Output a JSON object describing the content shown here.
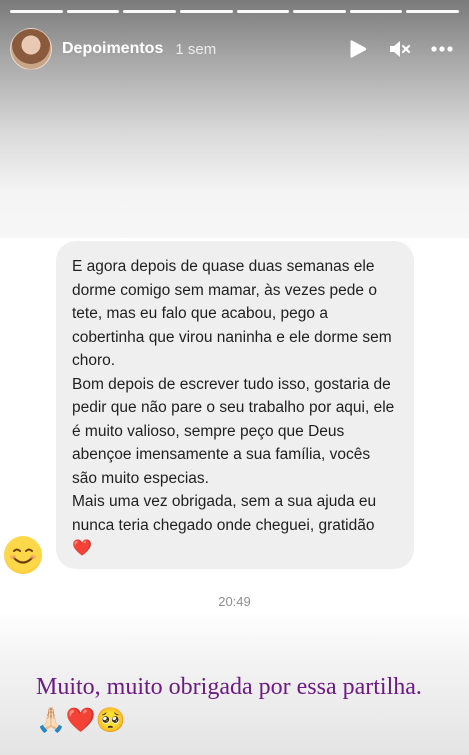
{
  "story": {
    "username": "Depoimentos",
    "time_ago": "1 sem",
    "progress_segments": 8,
    "progress_active": 8
  },
  "icons": {
    "play": "play-icon",
    "mute": "speaker-muted-icon",
    "more": "more-horizontal-icon"
  },
  "message": {
    "paragraphs": [
      "E agora depois de quase duas semanas ele dorme comigo sem mamar, às vezes pede o tete, mas eu falo que acabou, pego a cobertinha que virou naninha e ele dorme sem choro.",
      "Bom depois de escrever tudo isso, gostaria de pedir que não pare o seu trabalho por aqui, ele é muito valioso, sempre peço que Deus abençoe imensamente a sua família, vocês são muito especias.",
      "Mais uma vez obrigada, sem a sua ajuda eu nunca teria chegado onde cheguei, gratidão"
    ],
    "heart_emoji": "❤️",
    "time": "20:49",
    "reaction_emoji": "😊"
  },
  "caption": {
    "text": "Muito, muito obrigada por essa partilha. 🙏🏻❤️🥺"
  },
  "colors": {
    "caption": "#6d1a86",
    "bubble": "#efefef"
  }
}
